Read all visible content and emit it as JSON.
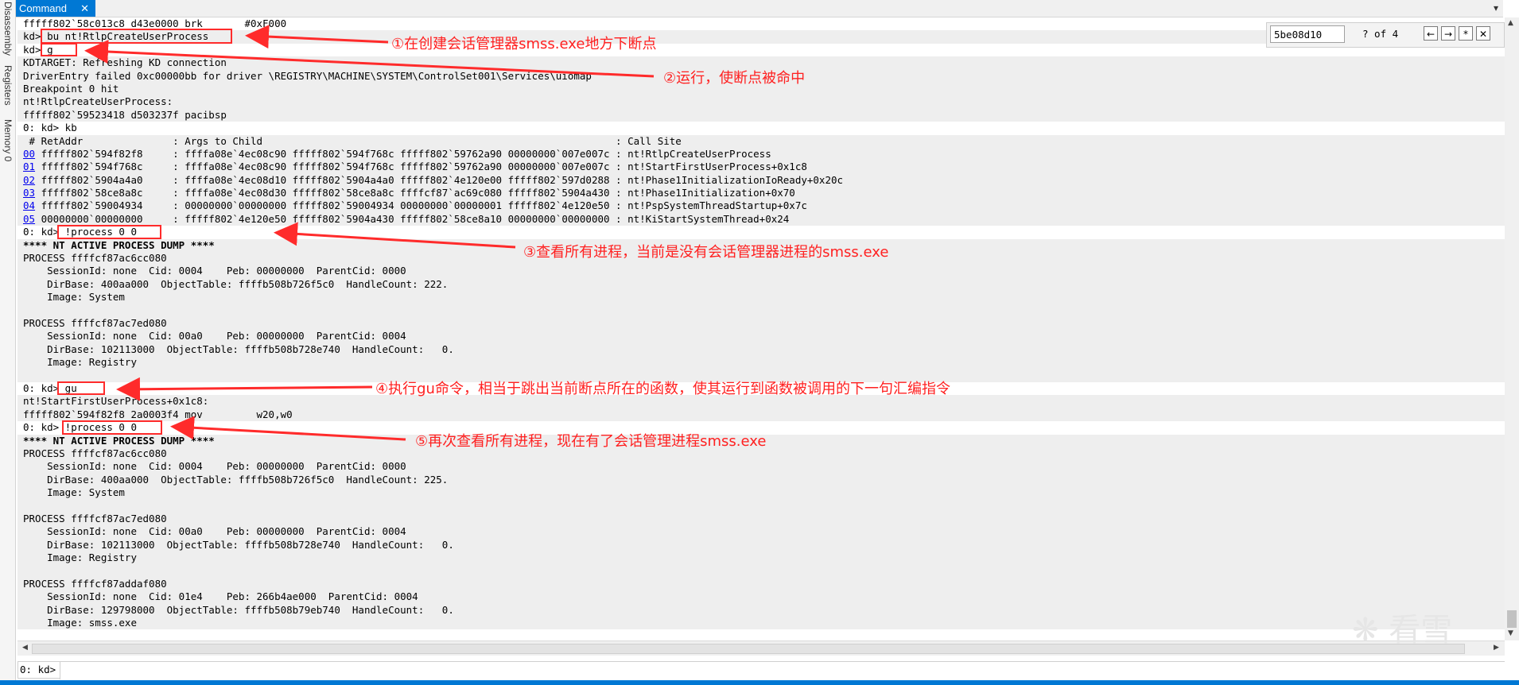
{
  "sidebar": {
    "tabs": [
      "Disassembly",
      "Registers",
      "Memory 0"
    ]
  },
  "tabbar": {
    "tab_label": "Command",
    "close": "✕",
    "menu": "▾"
  },
  "find": {
    "value": "5be08d10",
    "count": "? of 4",
    "prev": "←",
    "next": "→",
    "regex": "*",
    "close": "✕"
  },
  "output_lines": [
    {
      "text": "fffff802`58c013c8 d43e0000 brk       #0xF000",
      "shade": false
    },
    {
      "text": "kd> bu nt!RtlpCreateUserProcess",
      "shade": true
    },
    {
      "text": "kd> g",
      "shade": false
    },
    {
      "text": "KDTARGET: Refreshing KD connection",
      "shade": true
    },
    {
      "text": "DriverEntry failed 0xc00000bb for driver \\REGISTRY\\MACHINE\\SYSTEM\\ControlSet001\\Services\\uiomap",
      "shade": true
    },
    {
      "text": "Breakpoint 0 hit",
      "shade": true
    },
    {
      "text": "nt!RtlpCreateUserProcess:",
      "shade": true
    },
    {
      "text": "fffff802`59523418 d503237f pacibsp",
      "shade": true
    },
    {
      "text": "0: kd> kb",
      "shade": false
    },
    {
      "text": " # RetAddr               : Args to Child                                                           : Call Site",
      "shade": true
    },
    {
      "text": "00 fffff802`594f82f8     : ffffa08e`4ec08c90 fffff802`594f768c fffff802`59762a90 00000000`007e007c : nt!RtlpCreateUserProcess",
      "shade": true,
      "link": "00"
    },
    {
      "text": "01 fffff802`594f768c     : ffffa08e`4ec08c90 fffff802`594f768c fffff802`59762a90 00000000`007e007c : nt!StartFirstUserProcess+0x1c8",
      "shade": true,
      "link": "01"
    },
    {
      "text": "02 fffff802`5904a4a0     : ffffa08e`4ec08d10 fffff802`5904a4a0 fffff802`4e120e00 fffff802`597d0288 : nt!Phase1InitializationIoReady+0x20c",
      "shade": true,
      "link": "02"
    },
    {
      "text": "03 fffff802`58ce8a8c     : ffffa08e`4ec08d30 fffff802`58ce8a8c ffffcf87`ac69c080 fffff802`5904a430 : nt!Phase1Initialization+0x70",
      "shade": true,
      "link": "03"
    },
    {
      "text": "04 fffff802`59004934     : 00000000`00000000 fffff802`59004934 00000000`00000001 fffff802`4e120e50 : nt!PspSystemThreadStartup+0x7c",
      "shade": true,
      "link": "04"
    },
    {
      "text": "05 00000000`00000000     : fffff802`4e120e50 fffff802`5904a430 fffff802`58ce8a10 00000000`00000000 : nt!KiStartSystemThread+0x24",
      "shade": true,
      "link": "05"
    },
    {
      "text": "0: kd> !process 0 0",
      "shade": false
    },
    {
      "text": "**** NT ACTIVE PROCESS DUMP ****",
      "shade": true,
      "bold": true
    },
    {
      "text": "PROCESS ffffcf87ac6cc080",
      "shade": true
    },
    {
      "text": "    SessionId: none  Cid: 0004    Peb: 00000000  ParentCid: 0000",
      "shade": true
    },
    {
      "text": "    DirBase: 400aa000  ObjectTable: ffffb508b726f5c0  HandleCount: 222.",
      "shade": true
    },
    {
      "text": "    Image: System",
      "shade": true
    },
    {
      "text": "",
      "shade": true
    },
    {
      "text": "PROCESS ffffcf87ac7ed080",
      "shade": true
    },
    {
      "text": "    SessionId: none  Cid: 00a0    Peb: 00000000  ParentCid: 0004",
      "shade": true
    },
    {
      "text": "    DirBase: 102113000  ObjectTable: ffffb508b728e740  HandleCount:   0.",
      "shade": true
    },
    {
      "text": "    Image: Registry",
      "shade": true
    },
    {
      "text": "",
      "shade": true
    },
    {
      "text": "0: kd> gu",
      "shade": false
    },
    {
      "text": "nt!StartFirstUserProcess+0x1c8:",
      "shade": true
    },
    {
      "text": "fffff802`594f82f8 2a0003f4 mov         w20,w0",
      "shade": true
    },
    {
      "text": "0: kd> !process 0 0",
      "shade": false
    },
    {
      "text": "**** NT ACTIVE PROCESS DUMP ****",
      "shade": true,
      "bold": true
    },
    {
      "text": "PROCESS ffffcf87ac6cc080",
      "shade": true
    },
    {
      "text": "    SessionId: none  Cid: 0004    Peb: 00000000  ParentCid: 0000",
      "shade": true
    },
    {
      "text": "    DirBase: 400aa000  ObjectTable: ffffb508b726f5c0  HandleCount: 225.",
      "shade": true
    },
    {
      "text": "    Image: System",
      "shade": true
    },
    {
      "text": "",
      "shade": true
    },
    {
      "text": "PROCESS ffffcf87ac7ed080",
      "shade": true
    },
    {
      "text": "    SessionId: none  Cid: 00a0    Peb: 00000000  ParentCid: 0004",
      "shade": true
    },
    {
      "text": "    DirBase: 102113000  ObjectTable: ffffb508b728e740  HandleCount:   0.",
      "shade": true
    },
    {
      "text": "    Image: Registry",
      "shade": true
    },
    {
      "text": "",
      "shade": true
    },
    {
      "text": "PROCESS ffffcf87addaf080",
      "shade": true
    },
    {
      "text": "    SessionId: none  Cid: 01e4    Peb: 266b4ae000  ParentCid: 0004",
      "shade": true
    },
    {
      "text": "    DirBase: 129798000  ObjectTable: ffffb508b79eb740  HandleCount:   0.",
      "shade": true
    },
    {
      "text": "    Image: smss.exe",
      "shade": true
    }
  ],
  "annotations": [
    "①在创建会话管理器smss.exe地方下断点",
    "②运行，使断点被命中",
    "③查看所有进程，当前是没有会话管理器进程的smss.exe",
    "④执行gu命令，相当于跳出当前断点所在的函数，使其运行到函数被调用的下一句汇编指令",
    "⑤再次查看所有进程，现在有了会话管理进程smss.exe"
  ],
  "commandline": {
    "prompt": "0: kd>",
    "value": ""
  },
  "watermark": "❋ 看雪",
  "colors": {
    "accent": "#0078d4",
    "annotation": "#ff2020",
    "link": "#0000ee",
    "shade": "#eeeeee"
  }
}
